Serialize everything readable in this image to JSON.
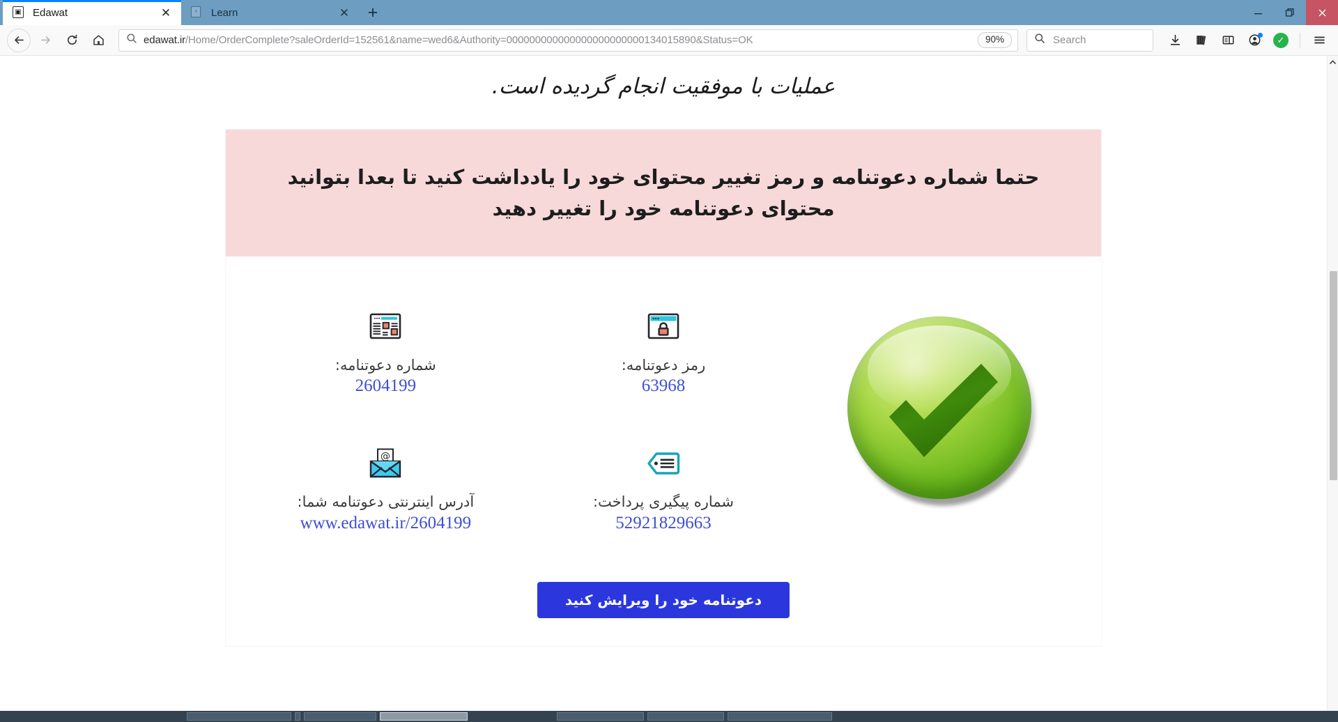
{
  "browser": {
    "tabs": [
      {
        "title": "Edawat",
        "favicon": "edawat-favicon",
        "active": true
      },
      {
        "title": "Learn",
        "favicon": "learn-favicon",
        "active": false
      }
    ],
    "newtab_label": "+",
    "window_controls": {
      "minimize": "minimize-icon",
      "restore": "restore-icon",
      "close": "close-icon"
    },
    "nav": {
      "back": "back-arrow-icon",
      "forward": "forward-arrow-icon",
      "reload": "reload-icon",
      "home": "home-icon"
    },
    "url": {
      "icon": "search-magnifier-icon",
      "domain": "edawat.ir",
      "path": "/Home/OrderComplete?saleOrderId=152561&name=wed6&Authority=000000000000000000000000134015890&Status=OK",
      "zoom_level": "90%"
    },
    "search": {
      "icon": "search-magnifier-icon",
      "placeholder": "Search"
    },
    "toolbar_icons": [
      {
        "name": "downloads-icon"
      },
      {
        "name": "library-icon"
      },
      {
        "name": "sidebar-icon"
      },
      {
        "name": "account-icon",
        "badge": true
      },
      {
        "name": "status-check-icon",
        "color": "#27b34b"
      },
      {
        "name": "menu-hamburger-icon"
      }
    ]
  },
  "page": {
    "heading": "عملیات با موفقیت انجام گردیده است.",
    "alert": "حتما شماره دعوتنامه و رمز تغییر محتوای خود را یادداشت کنید تا بعدا بتوانید محتوای دعوتنامه خود را تغییر دهید",
    "info_items": [
      {
        "icon": "browser-lock-icon",
        "label": "رمز دعوتنامه:",
        "value": "63968"
      },
      {
        "icon": "document-layout-icon",
        "label": "شماره دعوتنامه:",
        "value": "2604199"
      },
      {
        "icon": "tag-icon",
        "label": "شماره پیگیری پرداخت:",
        "value": "52921829663"
      },
      {
        "icon": "email-envelope-icon",
        "label": "آدرس اینترنتی دعوتنامه شما:",
        "value": "www.edawat.ir/2604199"
      }
    ],
    "success_graphic": "green-check-circle-icon",
    "edit_button": "دعوتنامه خود را ویرایش کنید",
    "colors": {
      "alert_bg": "#f7d9d9",
      "value_text": "#3f4fd4",
      "button_bg": "#2b37dd",
      "success_green": "#6fb91f"
    }
  }
}
